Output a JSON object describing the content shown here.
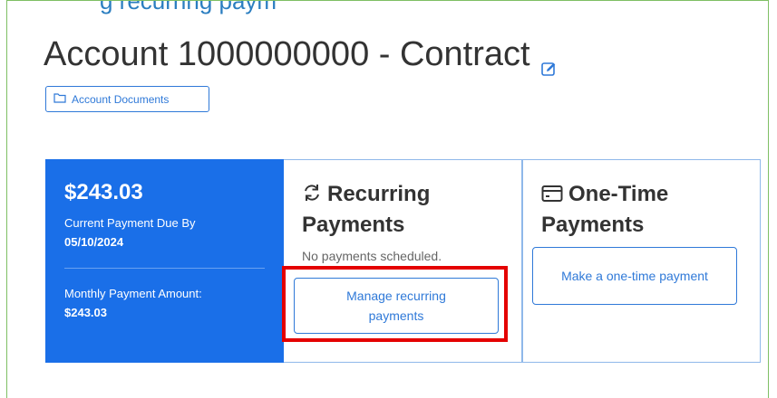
{
  "header": {
    "cut_text": "g recurring paym",
    "title": "Account 1000000000 - Contract",
    "edit_icon": "edit-icon"
  },
  "docs_button": {
    "label": "Account Documents",
    "icon": "folder-icon"
  },
  "due_card": {
    "amount": "$243.03",
    "due_label": "Current Payment Due By",
    "due_date": "05/10/2024",
    "monthly_label": "Monthly Payment Amount:",
    "monthly_amount": "$243.03"
  },
  "recurring_card": {
    "icon": "refresh-icon",
    "title": "Recurring Payments",
    "status": "No payments scheduled.",
    "button_label": "Manage recurring payments"
  },
  "one_time_card": {
    "icon": "credit-card-icon",
    "title": "One-Time Payments",
    "button_label": "Make a one-time payment"
  },
  "colors": {
    "primary": "#1a6fe8",
    "link": "#2f79d8",
    "highlight": "#e40000",
    "panel_border": "#7fbf64"
  }
}
